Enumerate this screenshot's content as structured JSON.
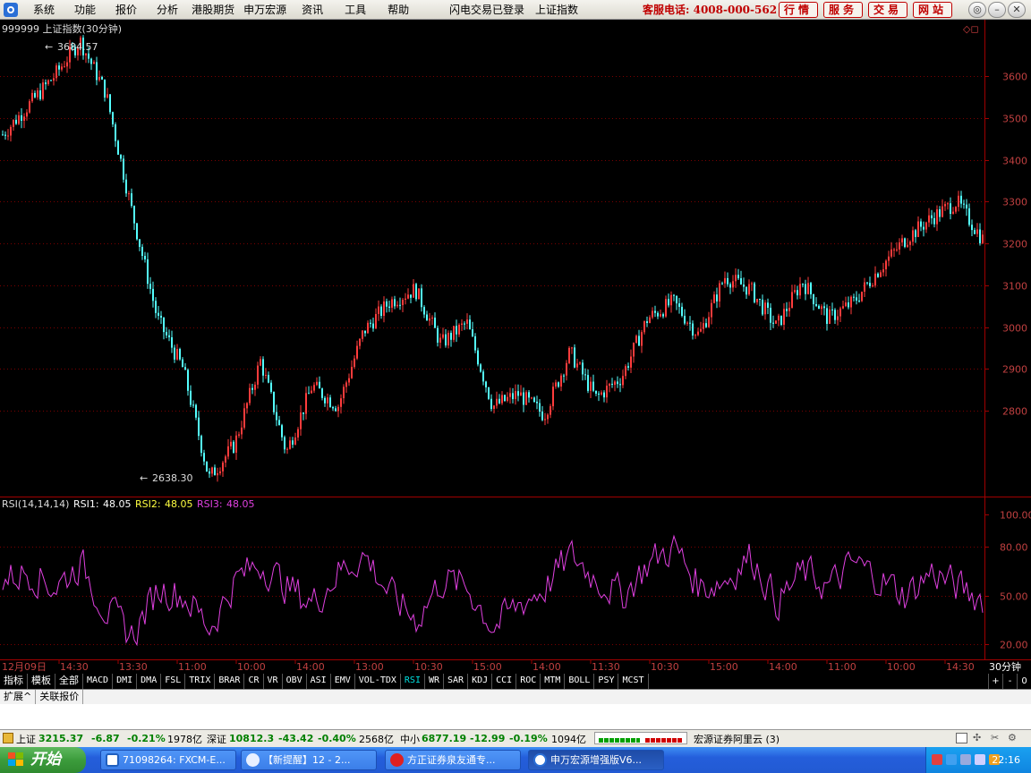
{
  "menubar": {
    "items": [
      "系统",
      "功能",
      "报价",
      "分析",
      "港股期货",
      "申万宏源",
      "资讯",
      "工具",
      "帮助"
    ],
    "login_status": "闪电交易已登录",
    "index_name": "上证指数",
    "hotline": "客服电话: 4008-000-562",
    "nav_buttons": [
      "行情",
      "服务",
      "交易",
      "网站"
    ]
  },
  "chart": {
    "header": "999999 上证指数(30分钟)",
    "high_label": "3684.57",
    "low_label": "2638.30",
    "y_ticks": [
      "3600",
      "3500",
      "3400",
      "3300",
      "3200",
      "3100",
      "3000",
      "2900",
      "2800"
    ],
    "indicator_header": {
      "name": "RSI(14,14,14)",
      "rsi1_label": "RSI1:",
      "rsi1_value": "48.05",
      "rsi2_label": "RSI2:",
      "rsi2_value": "48.05",
      "rsi3_label": "RSI3:",
      "rsi3_value": "48.05"
    },
    "rsi_ticks": [
      "100.00",
      "80.00",
      "50.00",
      "20.00"
    ],
    "x_labels": [
      "12月09日",
      "14:30",
      "13:30",
      "11:00",
      "10:00",
      "14:00",
      "13:00",
      "10:30",
      "15:00",
      "14:00",
      "11:30",
      "10:30",
      "15:00",
      "14:00",
      "11:00",
      "10:00",
      "14:30"
    ],
    "period_label": "30分钟",
    "colors": {
      "up": "#ff3c3c",
      "down": "#54ffff",
      "rsi": "#e040e0",
      "axis": "#a00000",
      "grid": "#7a0000"
    }
  },
  "chart_data": {
    "type": "line",
    "title": "999999 上证指数(30分钟)",
    "xlabel": "",
    "ylabel": "",
    "ylim": [
      2600,
      3700
    ],
    "x": [
      "12月09日",
      "14:30",
      "13:30",
      "11:00",
      "10:00",
      "14:00",
      "13:00",
      "10:30",
      "15:00",
      "14:00",
      "11:30",
      "10:30",
      "15:00",
      "14:00",
      "11:00",
      "10:00",
      "14:30"
    ],
    "series": [
      {
        "values": [
          3460,
          3530,
          3600,
          3684.57,
          3560,
          3280,
          3020,
          2900,
          2638.3,
          2720,
          2920,
          2700,
          2860,
          2810,
          2990,
          3060,
          3090,
          2960,
          3010,
          2810,
          2840,
          2790,
          2940,
          2830,
          2880,
          3020,
          3060,
          2980,
          3120,
          3090,
          3000,
          3110,
          3020,
          3060,
          3140,
          3210,
          3260,
          3300,
          3210
        ]
      },
      {
        "name": "RSI1",
        "values": [
          60,
          65,
          55,
          70,
          40,
          25,
          55,
          50,
          30,
          60,
          70,
          55,
          45,
          65,
          75,
          50,
          35,
          60,
          55,
          30,
          45,
          55,
          75,
          60,
          50,
          70,
          80,
          55,
          60,
          75,
          45,
          65,
          55,
          70,
          60,
          50,
          65,
          55,
          48.05
        ]
      }
    ]
  },
  "tabs": {
    "items": [
      "指标",
      "模板",
      "全部",
      "MACD",
      "DMI",
      "DMA",
      "FSL",
      "TRIX",
      "BRAR",
      "CR",
      "VR",
      "OBV",
      "ASI",
      "EMV",
      "VOL-TDX",
      "RSI",
      "WR",
      "SAR",
      "KDJ",
      "CCI",
      "ROC",
      "MTM",
      "BOLL",
      "PSY",
      "MCST"
    ],
    "active": "RSI",
    "right_buttons": [
      "+",
      "-",
      "0"
    ],
    "sub_tabs": [
      "扩展^",
      "关联报价"
    ]
  },
  "quotes": {
    "sh_label": "上证",
    "sh_price": "3215.37",
    "sh_change": "-6.87",
    "sh_pct": "-0.21%",
    "sh_amount": "1978亿",
    "sz_label": "深证",
    "sz_price": "10812.3",
    "sz_change": "-43.42",
    "sz_pct": "-0.40%",
    "sz_amount": "2568亿",
    "zx_label": "中小",
    "zx_price": "6877.19",
    "zx_change": "-12.99",
    "zx_pct": "-0.19%",
    "zx_amount": "1094亿",
    "broker": "宏源证券阿里云 (3)"
  },
  "taskbar": {
    "start_label": "开始",
    "tasks": [
      "71098264: FXCM-E...",
      "【新提醒】12 - 2...",
      "方正证券泉友通专...",
      "申万宏源增强版V6..."
    ],
    "clock": "22:16"
  }
}
